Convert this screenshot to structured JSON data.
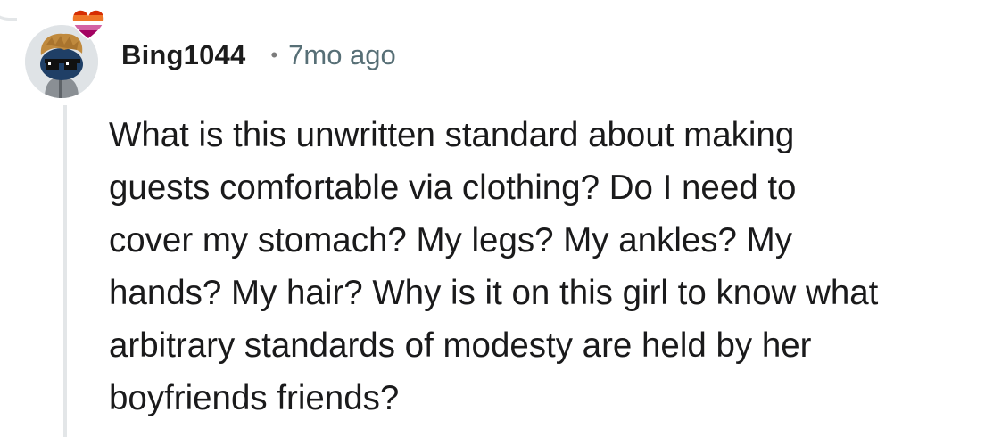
{
  "comment": {
    "author": "Bing1044",
    "separator": "•",
    "time_ago": "7mo ago",
    "body": "What is this unwritten standard about making\nguests comfortable via clothing? Do I need to\ncover my stomach? My legs? My ankles? My\nhands? My hair? Why is it on this girl to know what\narbitrary standards of modesty are held by her\nboyfriends friends?"
  },
  "icons": {
    "avatar": "snoo-avatar-with-sunglasses-icon",
    "flair": "rainbow-heart-icon"
  },
  "colors": {
    "username": "#1c1c1c",
    "timestamp": "#576f76",
    "body_text": "#1a1a1b",
    "thread_line": "#e3e6e8",
    "background": "#ffffff"
  }
}
